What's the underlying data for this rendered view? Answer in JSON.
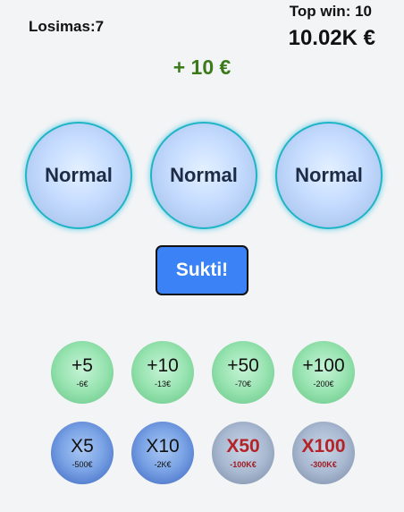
{
  "header": {
    "losimas": "Losimas:7",
    "top_win_label": "Top win: 10",
    "top_win_value": "10.02K €"
  },
  "win_message": "+ 10 €",
  "slots": [
    "Normal",
    "Normal",
    "Normal"
  ],
  "spin_label": "Sukti!",
  "bets": [
    {
      "label": "+5",
      "cost": "-6€"
    },
    {
      "label": "+10",
      "cost": "-13€"
    },
    {
      "label": "+50",
      "cost": "-70€"
    },
    {
      "label": "+100",
      "cost": "-200€"
    },
    {
      "label": "X5",
      "cost": "-500€"
    },
    {
      "label": "X10",
      "cost": "-2K€"
    },
    {
      "label": "X50",
      "cost": "-100K€"
    },
    {
      "label": "X100",
      "cost": "-300K€"
    }
  ],
  "colors": {
    "accent_button": "#3b82f6",
    "win_text": "#3b7a1a",
    "slot_border": "#1fb4c6",
    "locked_bet_text": "#b42328"
  }
}
